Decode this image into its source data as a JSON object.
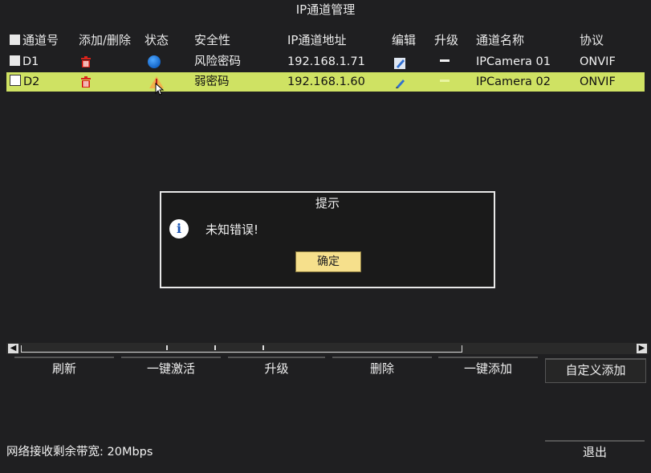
{
  "window": {
    "title": "IP通道管理"
  },
  "table": {
    "headers": {
      "num": "通道号",
      "add_del": "添加/删除",
      "state": "状态",
      "security": "安全性",
      "ip": "IP通道地址",
      "edit": "编辑",
      "upgrade": "升级",
      "name": "通道名称",
      "protocol": "协议"
    },
    "rows": [
      {
        "num": "D1",
        "security": "风险密码",
        "ip": "192.168.1.71",
        "name": "IPCamera 01",
        "protocol": "ONVIF",
        "state_icon": "globe-icon"
      },
      {
        "num": "D2",
        "security": "弱密码",
        "ip": "192.168.1.60",
        "name": "IPCamera 02",
        "protocol": "ONVIF",
        "state_icon": "warning-icon"
      }
    ]
  },
  "dialog": {
    "title": "提示",
    "message": "未知错误!",
    "ok_label": "确定"
  },
  "toolbar": {
    "refresh": "刷新",
    "one_click_activate": "一键激活",
    "upgrade": "升级",
    "delete": "删除",
    "one_click_add": "一键添加",
    "custom_add": "自定义添加"
  },
  "footer": {
    "bandwidth": "网络接收剩余带宽: 20Mbps",
    "exit": "退出"
  },
  "colors": {
    "selected_row": "#cfe263",
    "ok_button": "#f6e08c",
    "trash": "#d9231b"
  }
}
